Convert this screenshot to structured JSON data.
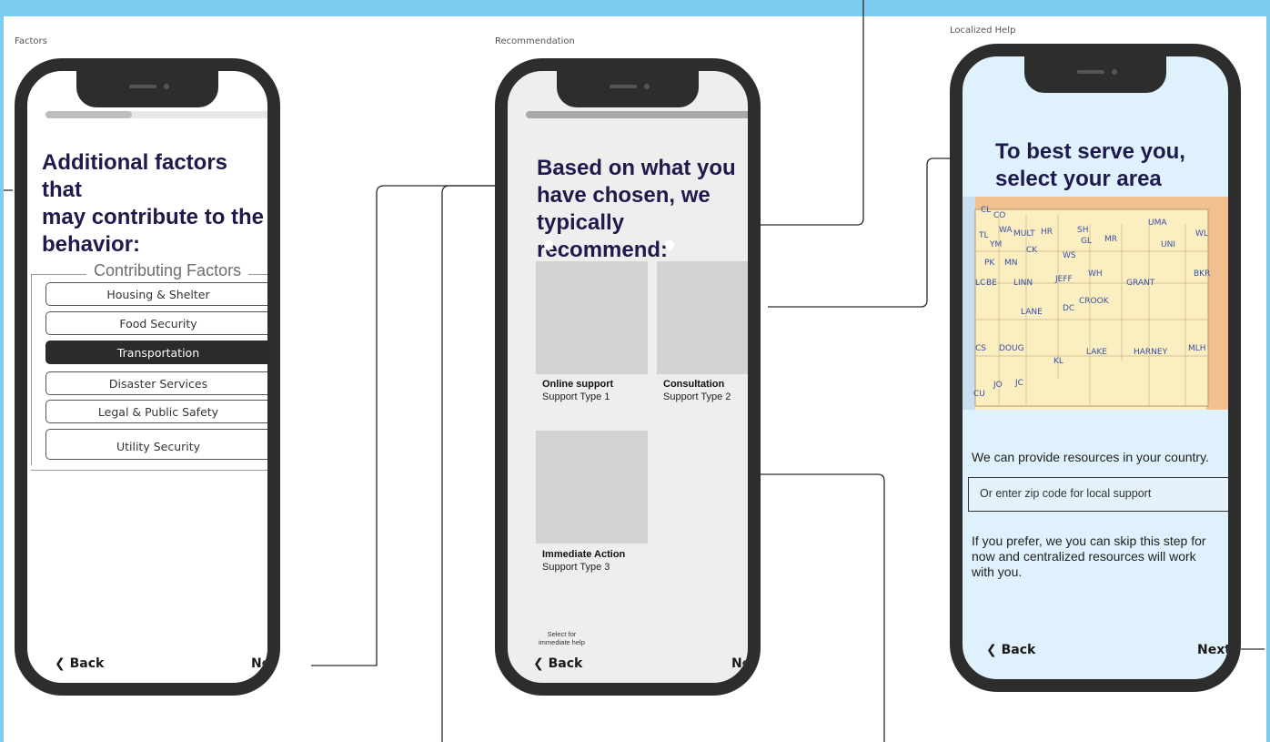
{
  "colors": {
    "accent": "#7fcdee",
    "heading": "#1e1a4d",
    "phone_frame": "#2d2d2d",
    "localized_bg": "#def1fc"
  },
  "frames": {
    "factors": {
      "label": "Factors",
      "progress": 0.34,
      "heading": [
        "Additional factors that",
        "may contribute to the",
        "behavior:"
      ],
      "legend": "Contributing Factors",
      "options": [
        {
          "label": "Housing & Shelter",
          "checked": false
        },
        {
          "label": "Food Security",
          "checked": false
        },
        {
          "label": "Transportation",
          "checked": true
        },
        {
          "label": "Disaster Services",
          "checked": false
        },
        {
          "label": "Legal & Public Safety",
          "checked": false
        },
        {
          "label": "Utility Security",
          "checked": false
        }
      ],
      "back": "Back",
      "next": "Next"
    },
    "recommendation": {
      "label": "Recommendation",
      "progress": 1.0,
      "heading": [
        "Based on what you",
        "have chosen, we",
        "typically recommend:"
      ],
      "cards": [
        {
          "title": "Online support",
          "subtitle": "Support Type 1"
        },
        {
          "title": "Consultation",
          "subtitle": "Support Type 2"
        },
        {
          "title": "Immediate Action",
          "subtitle": "Support Type 3"
        }
      ],
      "small_note": [
        "Select for",
        "immediate help"
      ],
      "back": "Back",
      "next": "Next"
    },
    "localized": {
      "label": "Localized Help",
      "heading": [
        "To best serve you,",
        "select your area"
      ],
      "map_labels": [
        "CL",
        "CO",
        "TL",
        "WA",
        "MULT",
        "HR",
        "SH",
        "GL",
        "MR",
        "UMA",
        "WL",
        "YM",
        "CK",
        "WS",
        "UNI",
        "PK",
        "MN",
        "WH",
        "BKR",
        "LC",
        "BE",
        "LINN",
        "JEFF",
        "GRANT",
        "CROOK",
        "DC",
        "LANE",
        "CS",
        "DOUG",
        "LAKE",
        "HARNEY",
        "MLH",
        "KL",
        "JO",
        "JC",
        "CU"
      ],
      "resources_text": "We can provide resources in your country.",
      "zip_placeholder": "Or enter zip code for local support",
      "skip_text": [
        "If you prefer, we you can skip this step for",
        "now and centralized resources will work",
        "with you."
      ],
      "back": "Back",
      "next": "Next"
    }
  }
}
